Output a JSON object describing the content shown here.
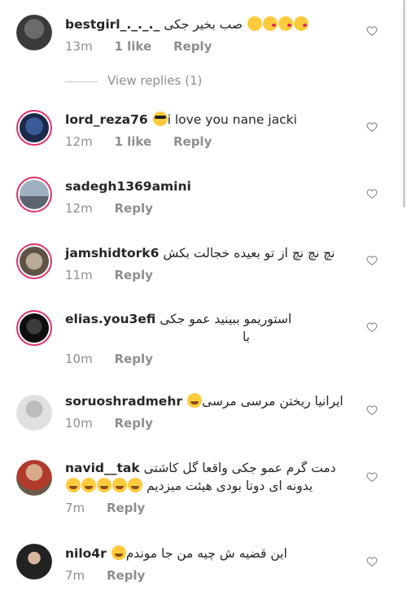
{
  "comments": [
    {
      "username": "bestgirl_._._._",
      "text": "صب بخیر جکی",
      "time": "13m",
      "likes": "1 like",
      "reply": "Reply",
      "emojis": [
        "smile",
        "kiss",
        "kiss",
        "kiss"
      ],
      "rtl": true,
      "ring": false,
      "avatar_color": "#4a4a4a"
    },
    {
      "username": "lord_reza76",
      "text": "i love you nane jacki",
      "time": "12m",
      "likes": "1 like",
      "reply": "Reply",
      "emojis_before": [
        "sunglasses"
      ],
      "ring": true,
      "avatar_color": "#2c3e70"
    },
    {
      "username": "sadegh1369amini",
      "text": "",
      "time": "12m",
      "reply": "Reply",
      "ring": true,
      "avatar_color": "#7a8a9a"
    },
    {
      "username": "jamshidtork6",
      "text": "نچ نچ نچ  از تو بعیده  خجالت بکش",
      "time": "11m",
      "reply": "Reply",
      "rtl": true,
      "ring": true,
      "avatar_color": "#9b8f80"
    },
    {
      "username": "elias.you3efi",
      "text": "استوریمو ببینید عمو جکی",
      "text2": "با",
      "time": "10m",
      "reply": "Reply",
      "rtl": true,
      "ring": true,
      "avatar_color": "#1a1a1a"
    },
    {
      "username": "soruoshradmehr",
      "text": "ایرانیا ریختن مرسی مرسی",
      "time": "10m",
      "reply": "Reply",
      "emojis": [
        "laugh"
      ],
      "rtl": true,
      "ring": false,
      "avatar_color": "#d5d5d5"
    },
    {
      "username": "navid__tak",
      "text": "دمت گرم عمو جکی واقعا گل کاشتی",
      "text2": "یدونه ای دوتا بودی هیئت میزدیم",
      "time": "7m",
      "reply": "Reply",
      "emojis2": [
        "laugh",
        "laugh",
        "laugh",
        "laugh",
        "laugh"
      ],
      "rtl": true,
      "ring": false,
      "avatar_color": "#b23a2a"
    },
    {
      "username": "nilo4r",
      "text": "این قضیه ش چیه من جا موندم",
      "time": "7m",
      "reply": "Reply",
      "emojis": [
        "laugh"
      ],
      "rtl": true,
      "ring": false,
      "avatar_color": "#2a2a2a"
    }
  ],
  "view_replies": "View replies (1)",
  "icons": {
    "like": "heart-outline-icon"
  }
}
